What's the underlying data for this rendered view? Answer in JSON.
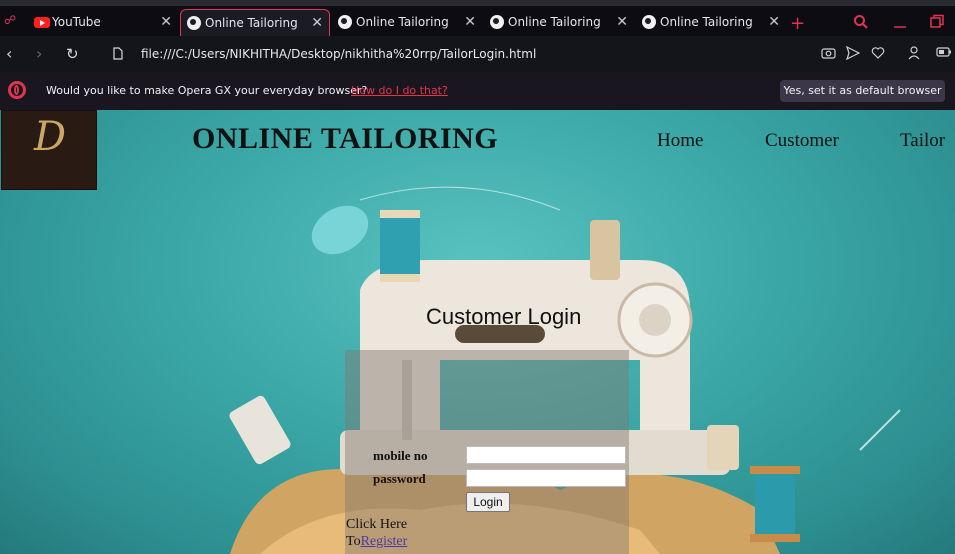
{
  "browser": {
    "tabs": [
      {
        "label": "YouTube",
        "icon": "youtube-icon",
        "active": false
      },
      {
        "label": "Online Tailoring",
        "icon": "globe-icon",
        "active": true
      },
      {
        "label": "Online Tailoring",
        "icon": "globe-icon",
        "active": false
      },
      {
        "label": "Online Tailoring",
        "icon": "globe-icon",
        "active": false
      },
      {
        "label": "Online Tailoring",
        "icon": "globe-icon",
        "active": false
      }
    ],
    "close_glyph": "✕",
    "new_tab_glyph": "+",
    "url": "file:///C:/Users/NIKHITHA/Desktop/nikhitha%20rrp/TailorLogin.html",
    "accent_color": "#e0354e"
  },
  "infobar": {
    "message": "Would you like to make Opera GX your everyday browser?",
    "link": "How do I do that?",
    "button": "Yes, set it as default browser"
  },
  "site": {
    "logo_letter": "D",
    "title": "ONLINE TAILORING",
    "menu": [
      "Home",
      "Customer",
      "Tailor"
    ]
  },
  "login": {
    "heading": "Customer Login",
    "mobile_label": "mobile no",
    "password_label": "password",
    "mobile_value": "",
    "password_value": "",
    "button": "Login",
    "click_here": "Click Here",
    "to": "To",
    "register": "Register"
  }
}
